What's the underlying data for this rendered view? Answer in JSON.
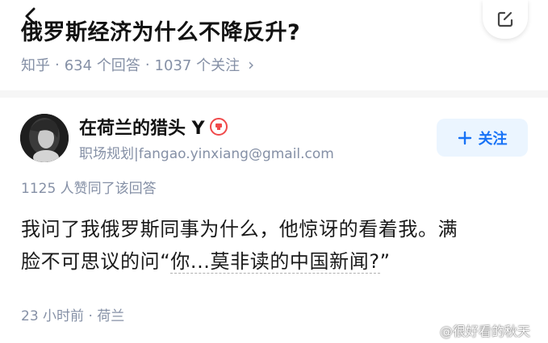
{
  "header": {
    "title": "俄罗斯经济为什么不降反升?",
    "platform": "知乎",
    "answers_count": "634 个回答",
    "followers_count": "1037 个关注",
    "separator": "·",
    "chevron": "›"
  },
  "author": {
    "name": "在荷兰的猎头 Y",
    "bio": "职场规划|fangao.yinxiang@gmail.com",
    "follow_label": "关注",
    "follow_icon": "plus-icon",
    "badge_icon": "award-badge-icon"
  },
  "answer": {
    "votes": "1125 人赞同了该回答",
    "line1": "我问了我俄罗斯同事为什么，他惊讶的看着我。满",
    "line2_prefix": "脸不可思议的问“",
    "line2_underlined": "你...莫非读的中国新闻?",
    "line2_suffix": "”",
    "time": "23 小时前 · 荷兰"
  },
  "watermark": {
    "text": "@很好看的秋天",
    "icon": "weibo-icon"
  },
  "colors": {
    "title": "#121212",
    "meta": "#8590a6",
    "accent": "#1772f6",
    "follow_bg": "#ebf5ff",
    "badge": "#f0494a"
  }
}
